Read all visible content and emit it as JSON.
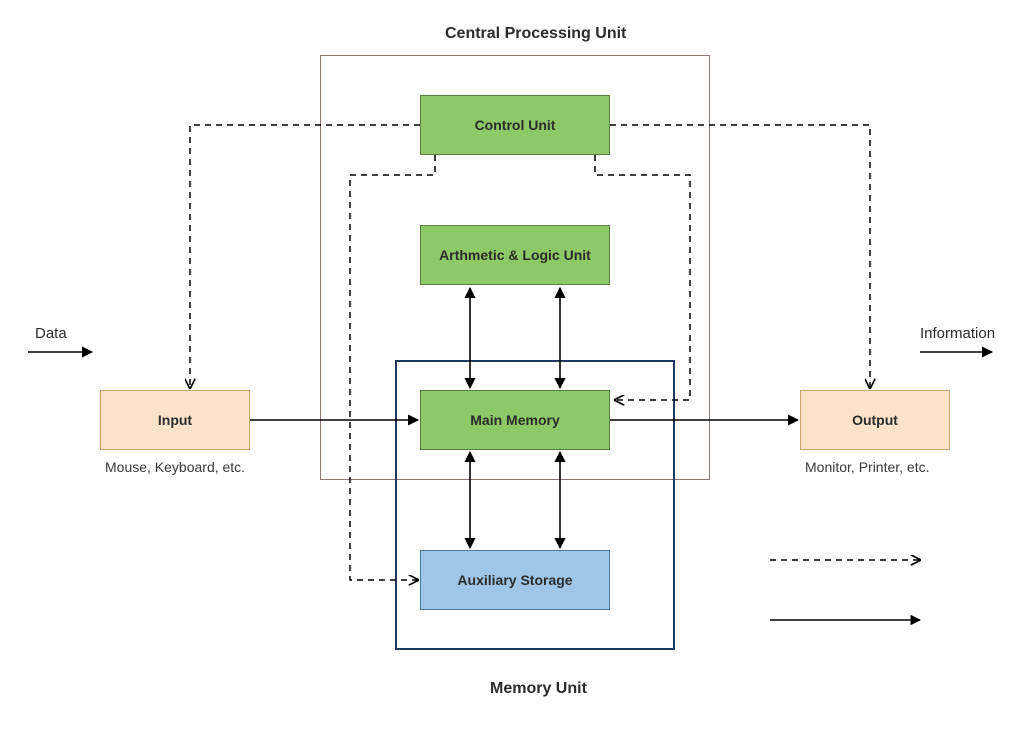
{
  "diagram": {
    "title_top": "Central Processing Unit",
    "title_bottom": "Memory Unit",
    "nodes": {
      "control_unit": "Control Unit",
      "alu": "Arthmetic & Logic Unit",
      "main_memory": "Main Memory",
      "aux_storage": "Auxiliary Storage",
      "input": "Input",
      "output": "Output"
    },
    "captions": {
      "input_sub": "Mouse, Keyboard, etc.",
      "output_sub": "Monitor, Printer, etc."
    },
    "external": {
      "data_label": "Data",
      "info_label": "Information"
    },
    "legend": {
      "dashed": "",
      "solid": ""
    },
    "colors": {
      "green": "#8ec967",
      "blue_box": "#9fc6e6",
      "peach": "#fbe3c9",
      "cpu_frame": "#8a7a74",
      "mem_frame": "#1f3a5f",
      "ink": "#000000"
    }
  }
}
